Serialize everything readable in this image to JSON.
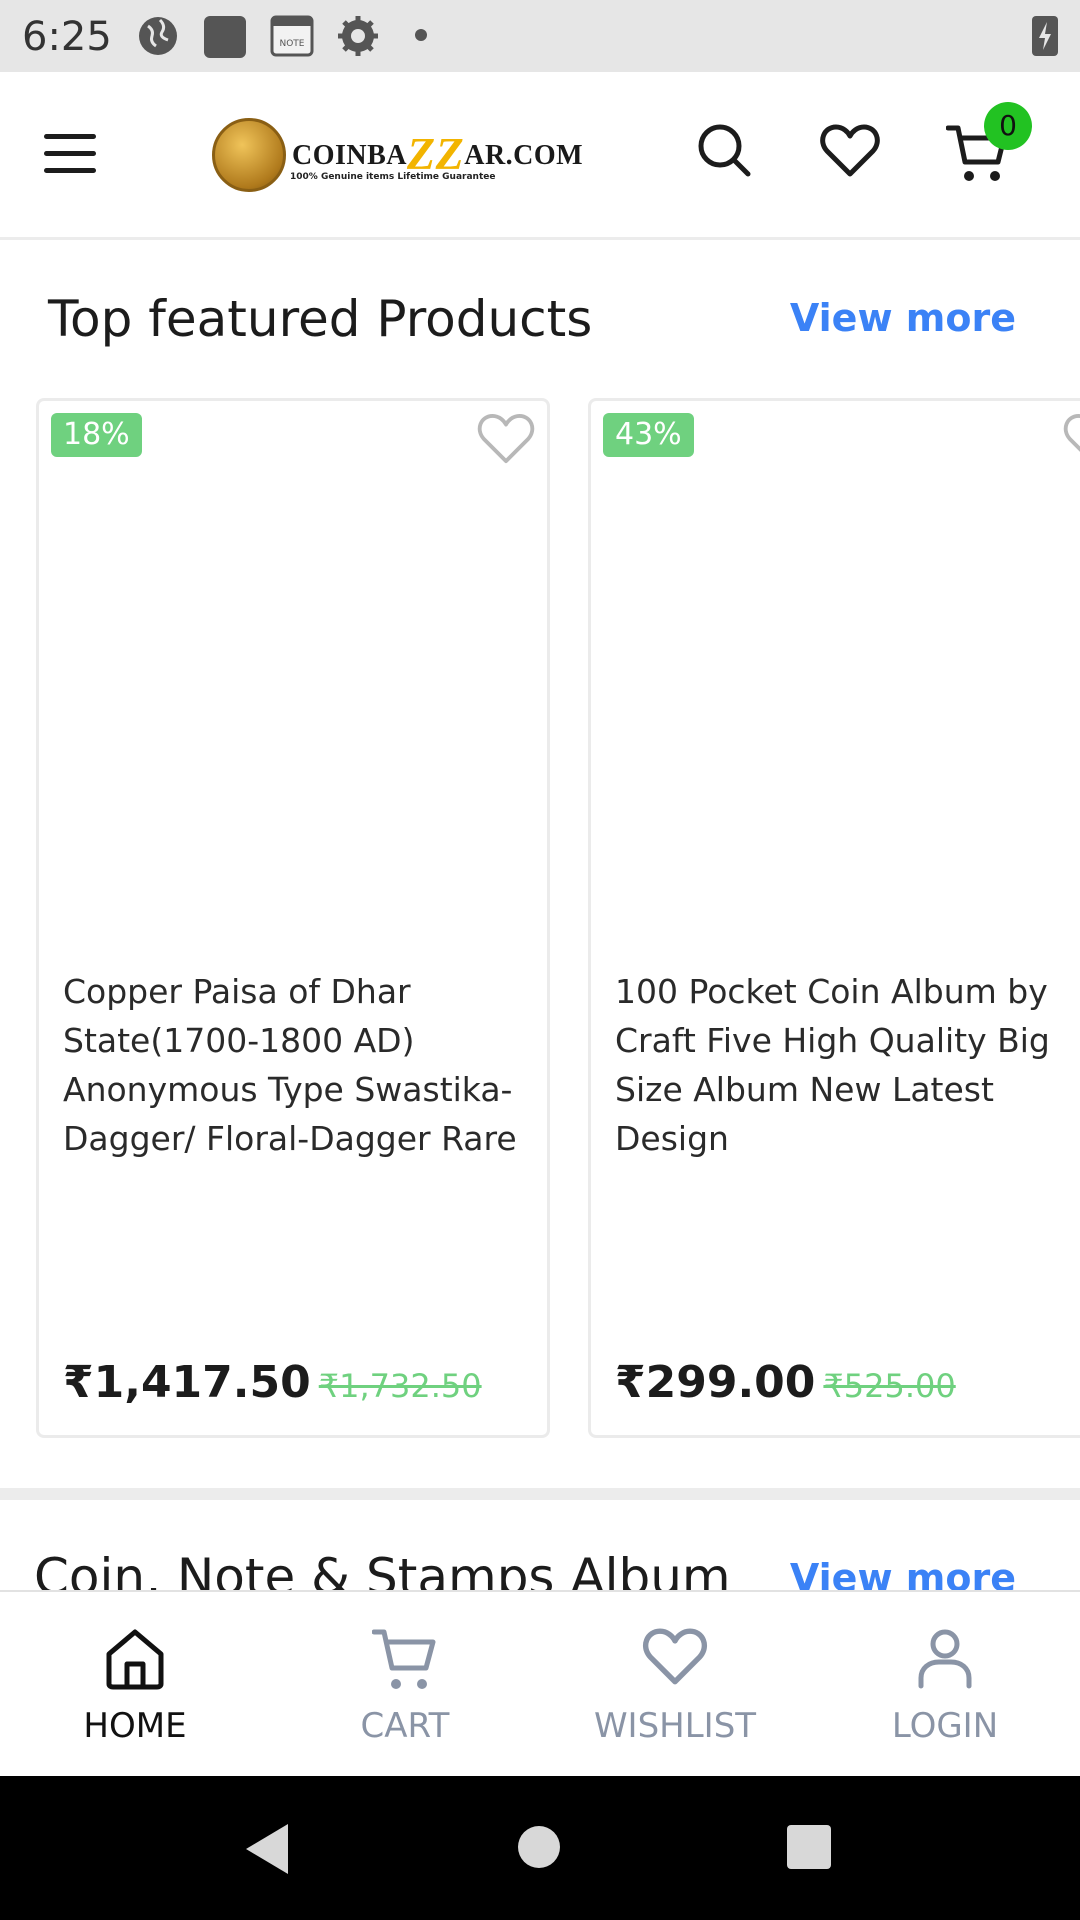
{
  "status_bar": {
    "time": "6:25",
    "icons": [
      "globe-icon",
      "square-icon",
      "note-icon",
      "gear-icon",
      "dot-icon"
    ],
    "note_label": "NOTE"
  },
  "header": {
    "logo_prefix": "COINBA",
    "logo_zz": "ZZ",
    "logo_suffix": "AR.COM",
    "logo_tagline": "100% Genuine items Lifetime Guarantee",
    "cart_count": "0"
  },
  "featured": {
    "title": "Top featured Products",
    "view_more": "View more",
    "products": [
      {
        "discount": "18%",
        "title": "Copper Paisa of Dhar State(1700-1800 AD) Anonymous Type Swastika-Dagger/ Floral-Dagger Rare",
        "price": "₹1,417.50",
        "old_price": "₹1,732.50"
      },
      {
        "discount": "43%",
        "title": "100 Pocket Coin Album by Craft Five High Quality Big Size Album New Latest Design",
        "price": "₹299.00",
        "old_price": "₹525.00"
      }
    ]
  },
  "section2": {
    "title": "Coin, Note & Stamps Album",
    "view_more": "View more"
  },
  "bottom_nav": {
    "items": [
      {
        "label": "HOME",
        "icon": "home-icon",
        "active": true
      },
      {
        "label": "CART",
        "icon": "cart-icon",
        "active": false
      },
      {
        "label": "WISHLIST",
        "icon": "heart-icon",
        "active": false
      },
      {
        "label": "LOGIN",
        "icon": "user-icon",
        "active": false
      }
    ]
  },
  "colors": {
    "accent_link": "#3b82f6",
    "discount_badge": "#6fd17f",
    "cart_badge": "#22c222"
  }
}
